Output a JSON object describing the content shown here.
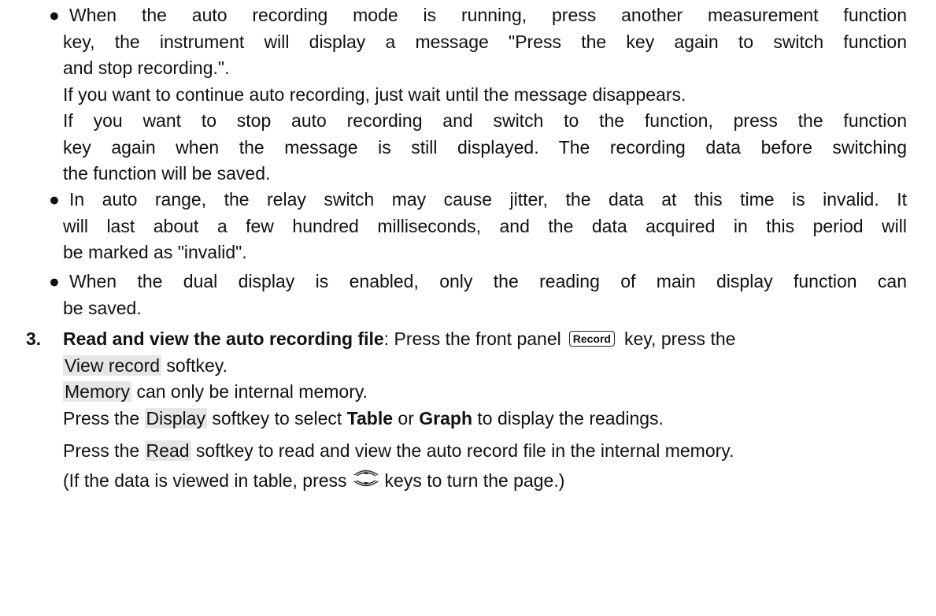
{
  "bullets": [
    {
      "lines": [
        "When the auto recording mode is running, press another measurement function",
        "key, the instrument will display a message \"Press the key again to switch function",
        "and stop recording.\"."
      ],
      "extra": [
        "If you want to continue auto recording, just wait until the message disappears.",
        "If you want to stop auto recording and switch to the function, press the function",
        "key again when the message is still displayed. The recording data before switching",
        "the function will be saved."
      ]
    },
    {
      "lines": [
        "In auto range, the relay switch may cause jitter, the data at this time is invalid. It",
        "will last about a few hundred milliseconds, and the data acquired in this period will",
        "be marked as \"invalid\"."
      ]
    },
    {
      "lines": [
        "When the dual display is enabled, only the reading of main display function can",
        "be saved."
      ]
    }
  ],
  "bullet_symbol": "●",
  "step": {
    "number": "3.",
    "title": "Read and view the auto recording file",
    "line1_a": ": Press the front panel",
    "key_record": "Record",
    "line1_b": "key, press the",
    "view_record": "View record",
    "softkey_word": " softkey.",
    "memory_label": "Memory",
    "memory_rest": " can only be internal memory.",
    "press_the": "Press the ",
    "display_label": "Display",
    "display_rest_a": " softkey to select ",
    "table_word": "Table",
    "or_word": " or ",
    "graph_word": "Graph",
    "display_rest_b": " to display the readings.",
    "read_label": "Read",
    "read_rest": " softkey to read and view the auto record file in the internal memory.",
    "page_a": "(If the data is viewed in table, press",
    "page_icon": "up-down-arrow-keys-icon",
    "page_b": "keys to turn the page.)"
  }
}
